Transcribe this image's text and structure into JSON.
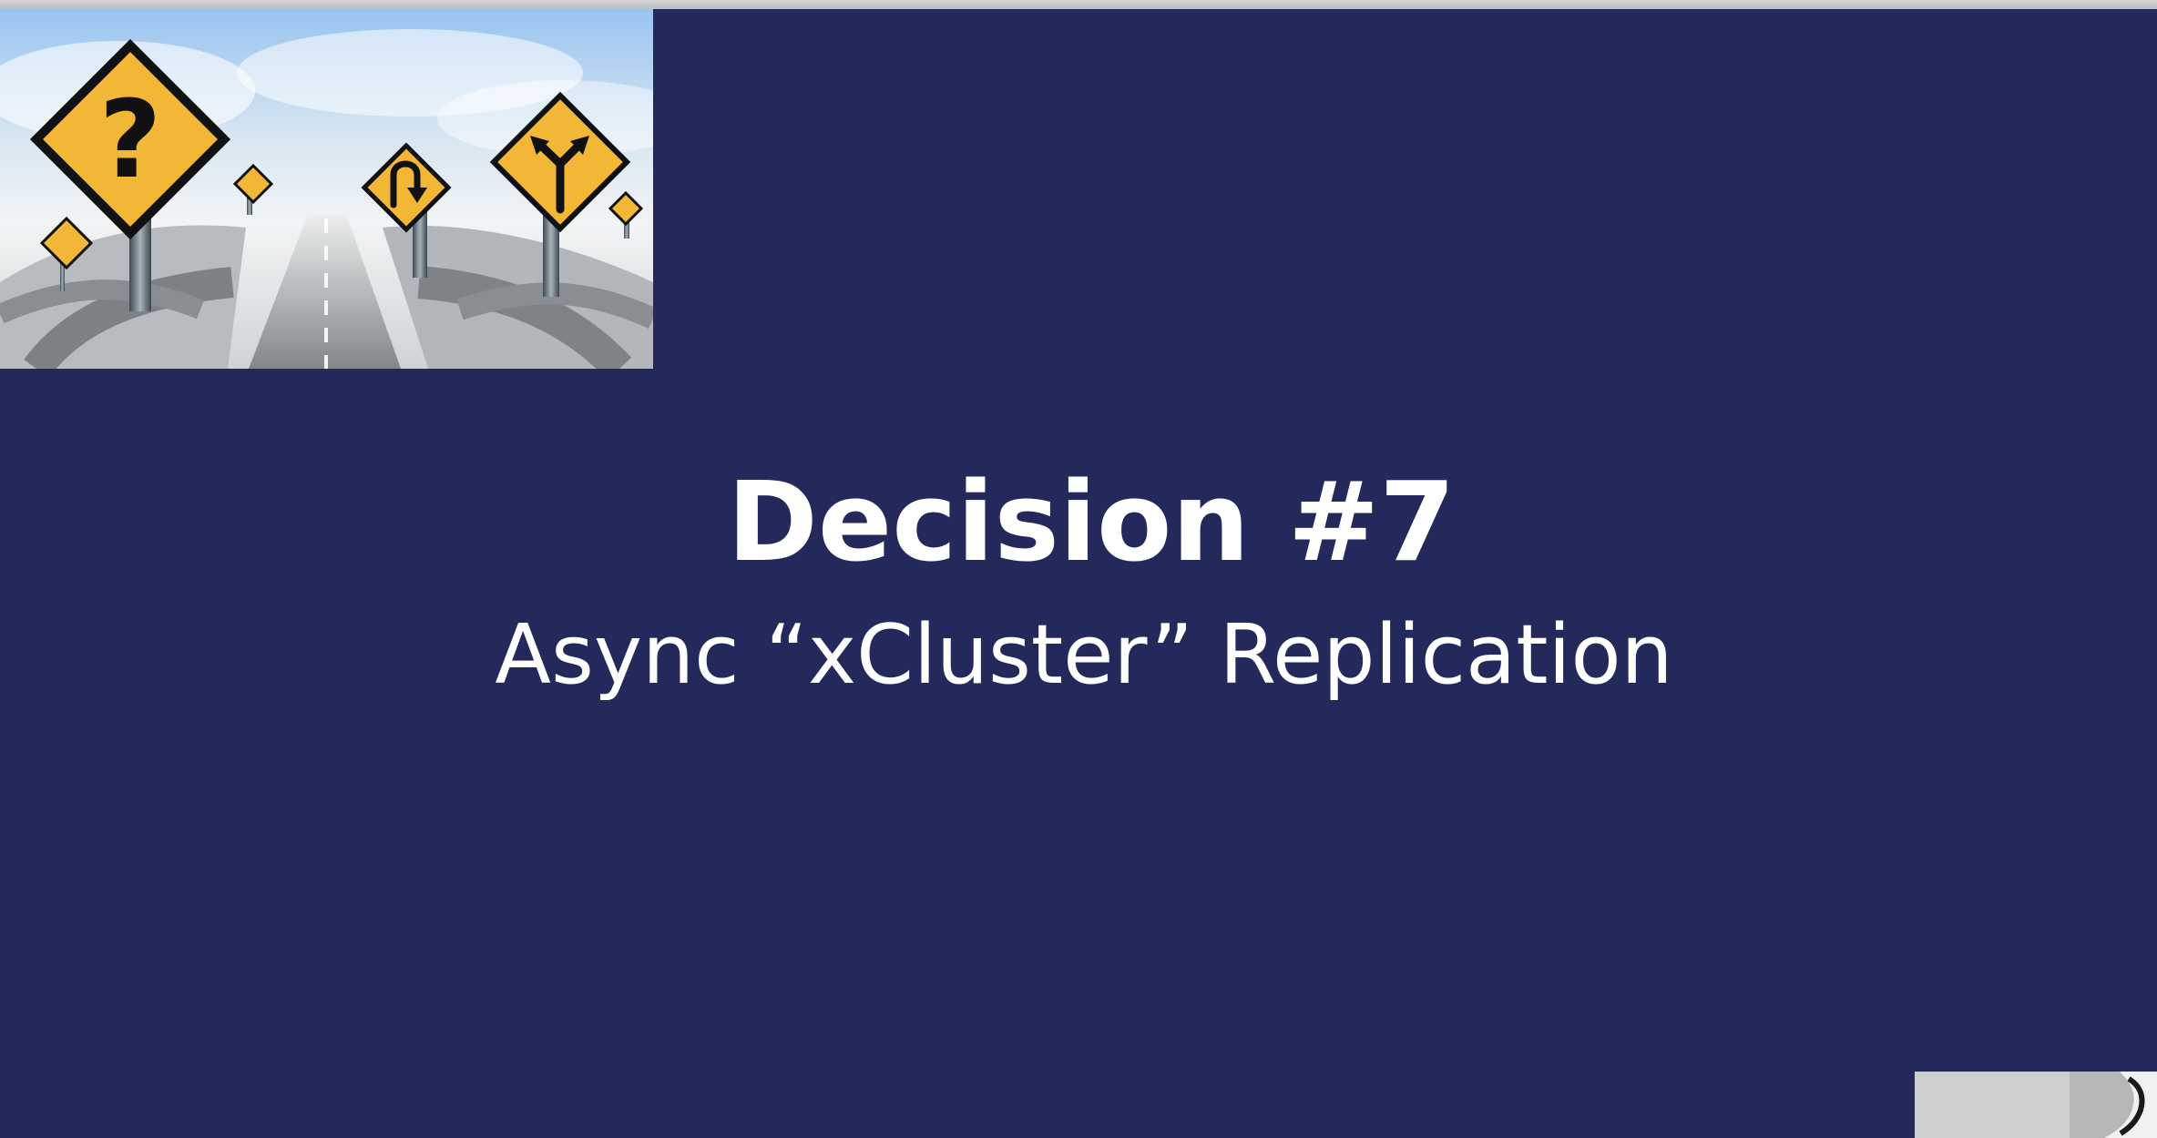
{
  "slide": {
    "title": "Decision #7",
    "subtitle": "Async “xCluster” Replication"
  },
  "hero_image": {
    "description": "crossroads-road-signs-image",
    "icons": [
      "question-mark-sign-icon",
      "u-turn-sign-icon",
      "fork-sign-icon"
    ]
  },
  "colors": {
    "background": "#24295b",
    "text": "#ffffff",
    "sign_yellow": "#f2b736",
    "sign_black": "#111111"
  },
  "presenter_thumbnail": {
    "icon": "webcam-thumbnail-icon"
  }
}
